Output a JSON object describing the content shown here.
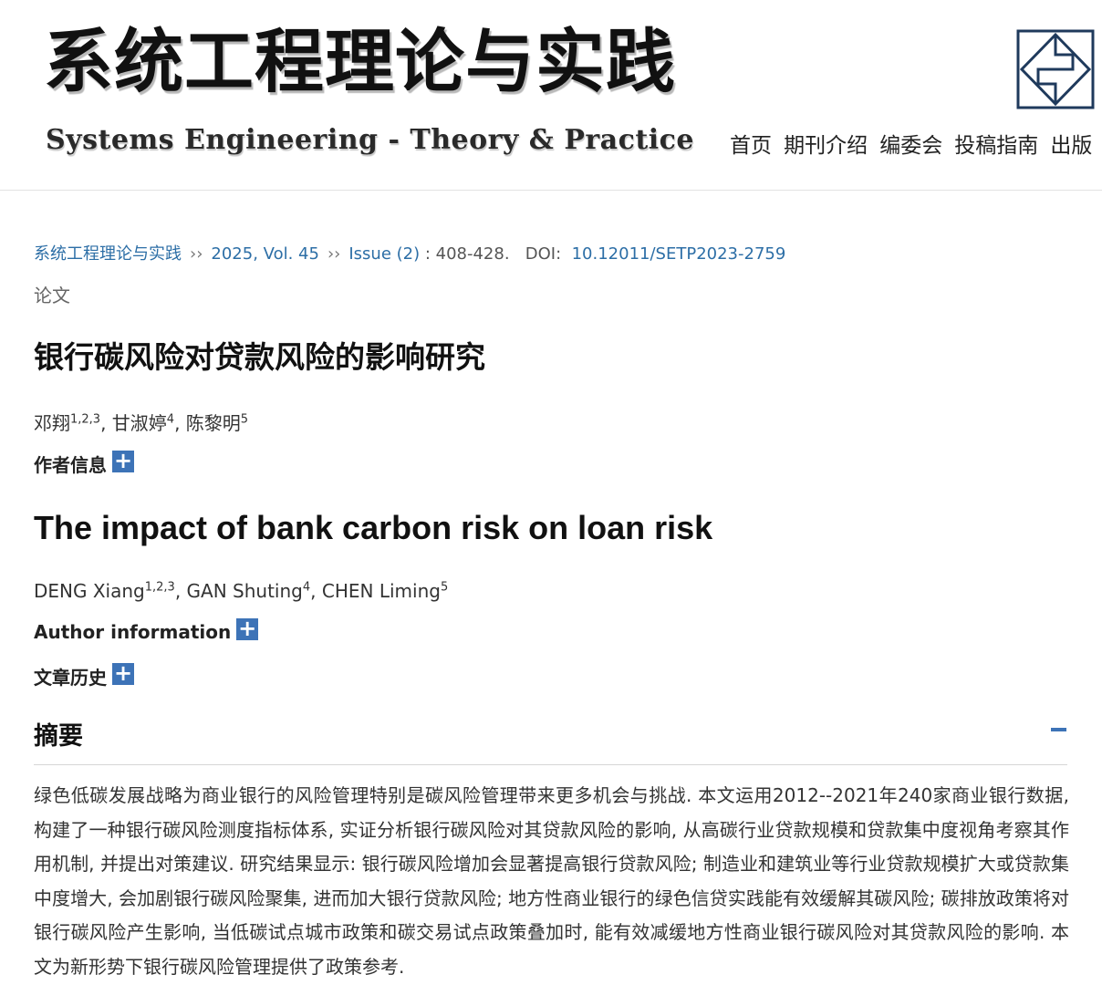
{
  "journal": {
    "title_cn": "系统工程理论与实践",
    "title_en": "Systems Engineering - Theory & Practice"
  },
  "nav": [
    "首页",
    "期刊介绍",
    "编委会",
    "投稿指南",
    "出版"
  ],
  "breadcrumb": {
    "journal": "系统工程理论与实践",
    "volume": "2025, Vol. 45",
    "issue": "Issue (2)",
    "pages": ": 408-428.",
    "doi_label": "DOI:",
    "doi": "10.12011/SETP2023-2759"
  },
  "article": {
    "column": "论文",
    "title_cn": "银行碳风险对贷款风险的影响研究",
    "authors_cn": [
      {
        "name": "邓翔",
        "aff": "1,2,3"
      },
      {
        "name": "甘淑婷",
        "aff": "4"
      },
      {
        "name": "陈黎明",
        "aff": "5"
      }
    ],
    "author_info_cn": "作者信息",
    "title_en": "The impact of bank carbon risk on loan risk",
    "authors_en": [
      {
        "name": "DENG Xiang",
        "aff": "1,2,3"
      },
      {
        "name": "GAN Shuting",
        "aff": "4"
      },
      {
        "name": "CHEN Liming",
        "aff": "5"
      }
    ],
    "author_info_en": "Author information",
    "history": "文章历史",
    "separator": ", "
  },
  "abstract": {
    "heading": "摘要",
    "text": "绿色低碳发展战略为商业银行的风险管理特别是碳风险管理带来更多机会与挑战. 本文运用2012--2021年240家商业银行数据, 构建了一种银行碳风险测度指标体系, 实证分析银行碳风险对其贷款风险的影响, 从高碳行业贷款规模和贷款集中度视角考察其作用机制, 并提出对策建议. 研究结果显示: 银行碳风险增加会显著提高银行贷款风险; 制造业和建筑业等行业贷款规模扩大或贷款集中度增大, 会加剧银行碳风险聚集, 进而加大银行贷款风险; 地方性商业银行的绿色信贷实践能有效缓解其碳风险; 碳排放政策将对银行碳风险产生影响, 当低碳试点城市政策和碳交易试点政策叠加时, 能有效减缓地方性商业银行碳风险对其贷款风险的影响. 本文为新形势下银行碳风险管理提供了政策参考."
  },
  "icons": {
    "expand": "plus-icon",
    "collapse": "minus-icon",
    "breadcrumb_sep": "››"
  },
  "colors": {
    "link": "#2c6ea6",
    "accent": "#3d73b7",
    "emblem": "#1f3a5c"
  }
}
